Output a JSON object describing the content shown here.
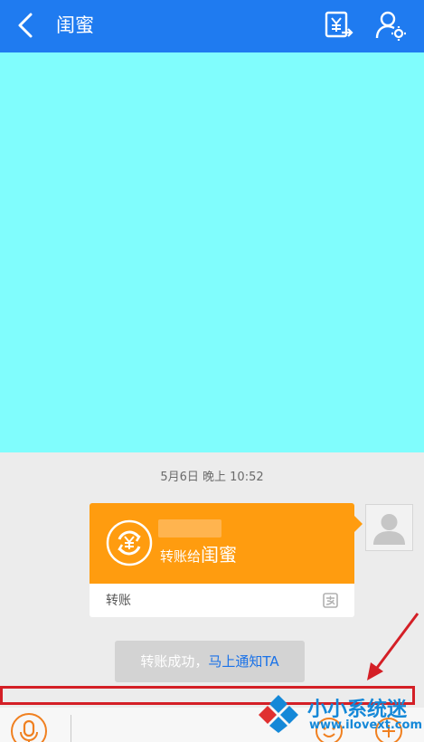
{
  "header": {
    "title": "闺蜜",
    "back_icon": "chevron-left-icon",
    "transfer_icon": "yuan-transfer-icon",
    "profile_icon": "user-settings-icon"
  },
  "chat": {
    "timestamp": "5月6日 晚上 10:52",
    "transfer_card": {
      "description_prefix": "转账给",
      "recipient": "闺蜜",
      "footer_label": "转账",
      "icon": "yuan-refresh-icon",
      "footer_icon": "alipay-icon"
    },
    "notice": {
      "text": "转账成功，",
      "link": "马上通知TA"
    }
  },
  "input_bar": {
    "voice_icon": "microphone-icon",
    "emoji_icon": "smile-icon",
    "more_icon": "plus-icon"
  },
  "watermark": {
    "name": "小小系统迷",
    "url": "www.ilovext.com"
  },
  "colors": {
    "header": "#1f7bf0",
    "cover": "#80fdfd",
    "card": "#ff9c0f",
    "link": "#1a72e8",
    "highlight": "#d41f26",
    "watermark": "#1488d8"
  }
}
